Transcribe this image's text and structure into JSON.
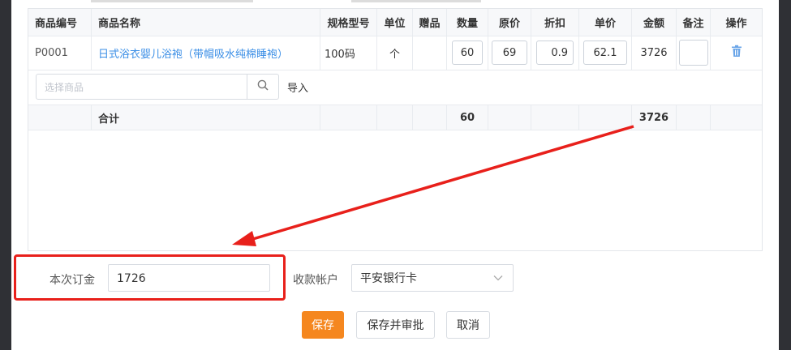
{
  "table": {
    "headers": {
      "code": "商品编号",
      "name": "商品名称",
      "spec": "规格型号",
      "unit": "单位",
      "gift": "赠品",
      "qty": "数量",
      "orig_price": "原价",
      "discount": "折扣",
      "unit_price": "单价",
      "amount": "金额",
      "remark": "备注",
      "action": "操作"
    },
    "row": {
      "code": "P0001",
      "name": "日式浴衣婴儿浴袍（带帽吸水纯棉睡袍）",
      "spec": "100码",
      "unit": "个",
      "gift": "",
      "qty": "60",
      "orig_price": "69",
      "discount": "0.9",
      "unit_price": "62.1",
      "amount": "3726",
      "remark": "",
      "action_icon": "trash-icon"
    },
    "search": {
      "placeholder": "选择商品",
      "icon": "search-icon",
      "import_label": "导入"
    },
    "total": {
      "label": "合计",
      "qty": "60",
      "amount": "3726"
    }
  },
  "form": {
    "deposit_label": "本次订金",
    "deposit_value": "1726",
    "account_label": "收款帐户",
    "account_value": "平安银行卡"
  },
  "buttons": {
    "save": "保存",
    "save_approve": "保存并审批",
    "cancel": "取消"
  },
  "colors": {
    "accent": "#f5871f",
    "link": "#3a8ee6",
    "annotation": "#e8201b"
  }
}
